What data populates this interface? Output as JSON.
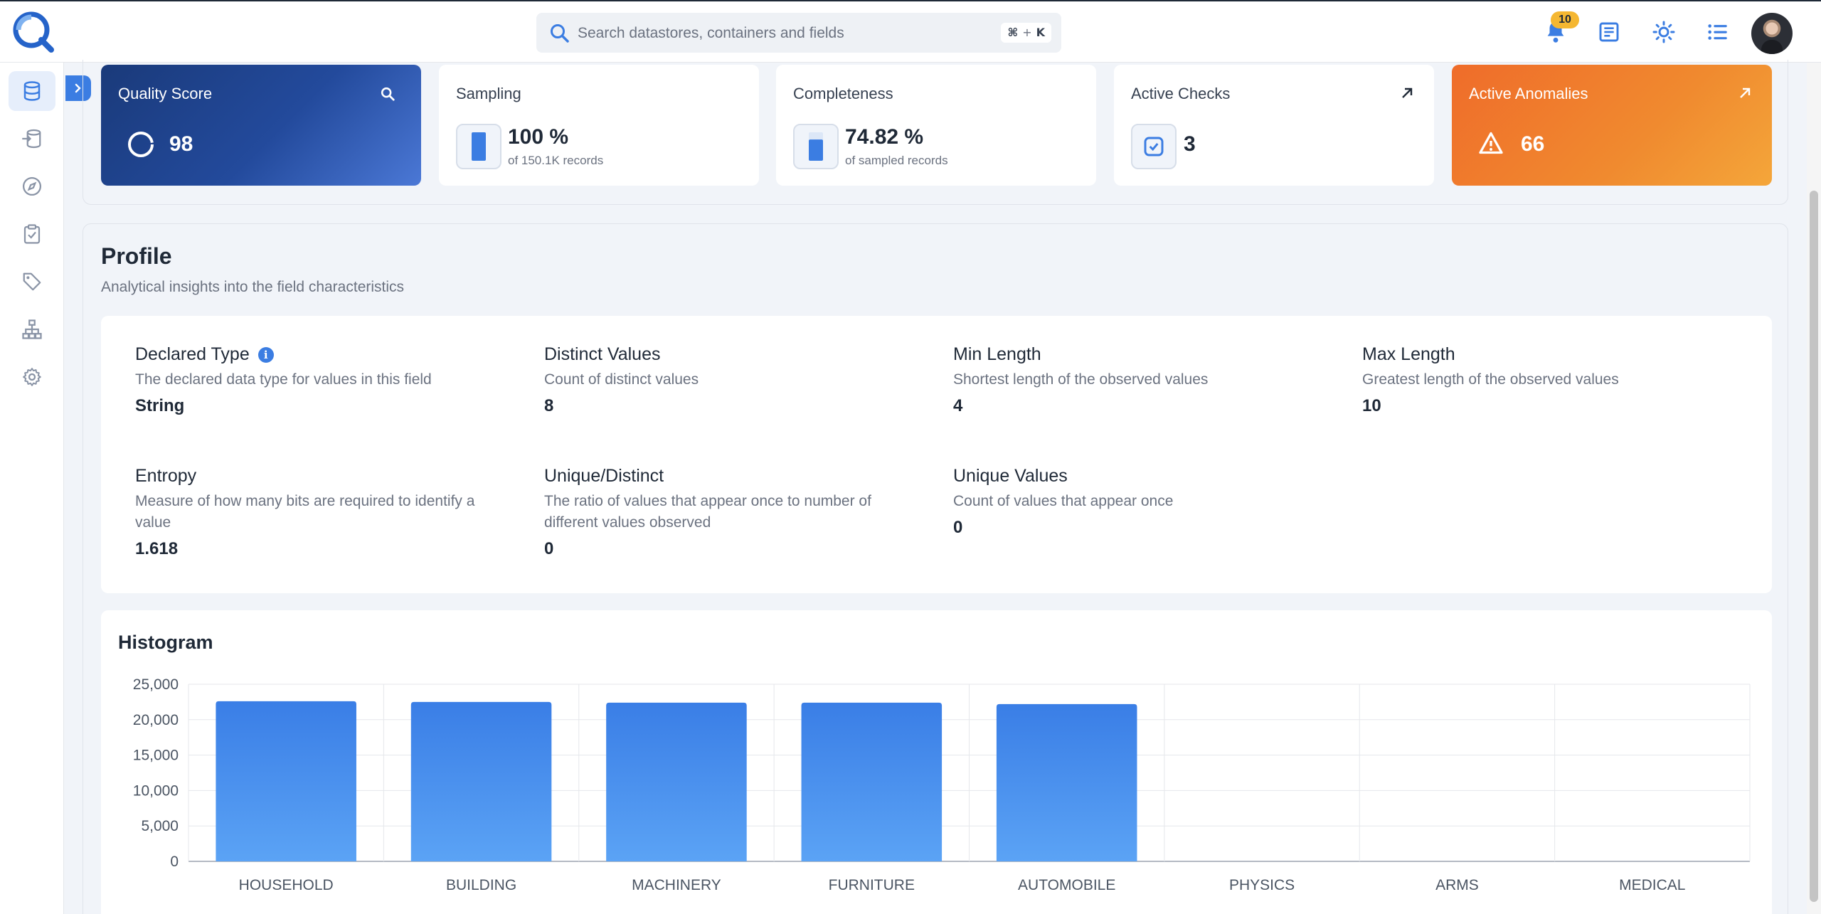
{
  "search": {
    "placeholder": "Search datastores, containers and fields",
    "shortcut_cmd": "⌘",
    "shortcut_plus": "+",
    "shortcut_key": "K"
  },
  "header": {
    "notification_count": "10"
  },
  "metrics": {
    "quality": {
      "title": "Quality Score",
      "value": "98"
    },
    "sampling": {
      "title": "Sampling",
      "value": "100 %",
      "sub": "of 150.1K records",
      "level_percent": 100
    },
    "completeness": {
      "title": "Completeness",
      "value": "74.82 %",
      "sub": "of sampled records",
      "level_percent": 74.82
    },
    "checks": {
      "title": "Active Checks",
      "value": "3"
    },
    "anomalies": {
      "title": "Active Anomalies",
      "value": "66"
    }
  },
  "profile": {
    "title": "Profile",
    "subtitle": "Analytical insights into the field characteristics",
    "stats": [
      {
        "label": "Declared Type",
        "desc": "The declared data type for values in this field",
        "value": "String"
      },
      {
        "label": "Distinct Values",
        "desc": "Count of distinct values",
        "value": "8"
      },
      {
        "label": "Min Length",
        "desc": "Shortest length of the observed values",
        "value": "4"
      },
      {
        "label": "Max Length",
        "desc": "Greatest length of the observed values",
        "value": "10"
      },
      {
        "label": "Entropy",
        "desc": "Measure of how many bits are required to identify a value",
        "value": "1.618"
      },
      {
        "label": "Unique/Distinct",
        "desc": "The ratio of values that appear once to number of different values observed",
        "value": "0"
      },
      {
        "label": "Unique Values",
        "desc": "Count of values that appear once",
        "value": "0"
      }
    ]
  },
  "colors": {
    "accent": "#3b7de2",
    "bar_top": "#3a7ee6",
    "bar_bottom": "#5ba3f5"
  },
  "chart_data": {
    "type": "bar",
    "title": "Histogram",
    "categories": [
      "HOUSEHOLD",
      "BUILDING",
      "MACHINERY",
      "FURNITURE",
      "AUTOMOBILE",
      "PHYSICS",
      "ARMS",
      "MEDICAL"
    ],
    "values": [
      22600,
      22500,
      22400,
      22400,
      22200,
      0,
      0,
      0
    ],
    "ylim": [
      0,
      25000
    ],
    "yticks": [
      "0",
      "5,000",
      "10,000",
      "15,000",
      "20,000",
      "25,000"
    ],
    "ytick_values": [
      0,
      5000,
      10000,
      15000,
      20000,
      25000
    ],
    "grid": true
  }
}
